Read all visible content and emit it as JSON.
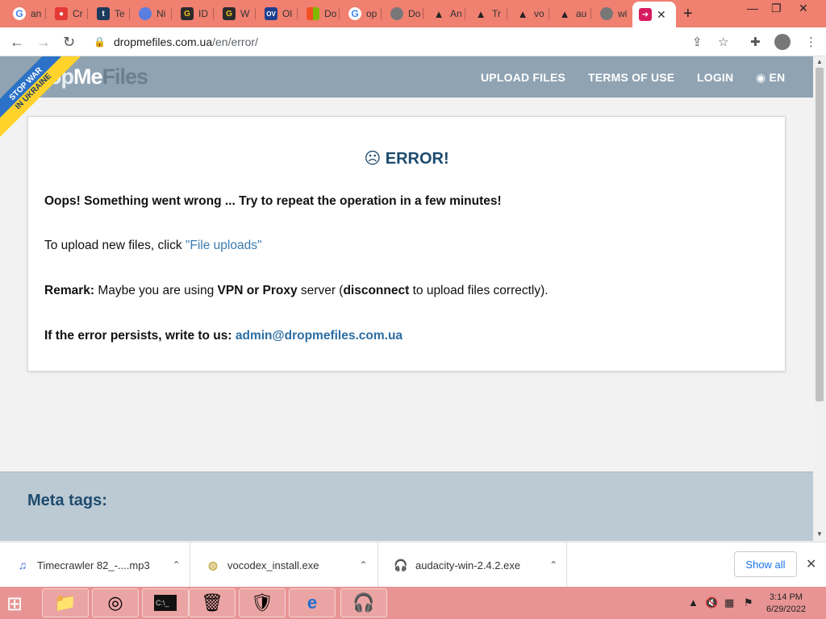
{
  "browser": {
    "tabs": [
      {
        "icon": "google-icon",
        "label": "an"
      },
      {
        "icon": "red-app-icon",
        "label": "Cr"
      },
      {
        "icon": "tumblr-icon",
        "label": "Te"
      },
      {
        "icon": "blue-drop-icon",
        "label": "Ni"
      },
      {
        "icon": "g-dark-icon",
        "label": "ID"
      },
      {
        "icon": "g-dark-icon",
        "label": "W"
      },
      {
        "icon": "ov-icon",
        "label": "Ol"
      },
      {
        "icon": "microsoft-icon",
        "label": "Do"
      },
      {
        "icon": "google-icon",
        "label": "op"
      },
      {
        "icon": "globe-icon",
        "label": "Do"
      },
      {
        "icon": "hill-icon",
        "label": "An"
      },
      {
        "icon": "hill-icon",
        "label": "Tr"
      },
      {
        "icon": "hill-icon",
        "label": "vo"
      },
      {
        "icon": "hill-icon",
        "label": "au"
      },
      {
        "icon": "globe-icon",
        "label": "wi"
      }
    ],
    "active_tab": {
      "icon": "dropmefiles-icon"
    },
    "url_host": "dropmefiles.com.ua",
    "url_path": "/en/error/"
  },
  "site": {
    "logo": {
      "part1": "op",
      "part2": "Me",
      "part3": "Files"
    },
    "ribbon": {
      "line1": "STOP WAR",
      "line2": "IN UKRAINE"
    },
    "nav": {
      "upload": "UPLOAD FILES",
      "terms": "TERMS OF USE",
      "login": "LOGIN",
      "lang": "EN"
    }
  },
  "error": {
    "face": "☹",
    "title": "ERROR!",
    "message": "Oops! Something went wrong ... Try to repeat the operation in a few minutes!",
    "upload_prefix": "To upload new files, click ",
    "upload_link": "\"File uploads\"",
    "remark_label": "Remark:",
    "remark_1": " Maybe you are using ",
    "remark_vpn": "VPN or Proxy",
    "remark_2": " server (",
    "remark_disconnect": "disconnect",
    "remark_3": " to upload files correctly).",
    "persist_label": "If the error persists, write to us: ",
    "email": "admin@dropmefiles.com.ua"
  },
  "meta": {
    "heading": "Meta tags:"
  },
  "downloads": {
    "items": [
      {
        "name": "Timecrawler 82_-....mp3"
      },
      {
        "name": "vocodex_install.exe"
      },
      {
        "name": "audacity-win-2.4.2.exe"
      }
    ],
    "show_all": "Show all"
  },
  "taskbar": {
    "time": "3:14 PM",
    "date": "6/29/2022"
  },
  "colors": {
    "tabstrip": "#f08070",
    "sitebar": "#8fa3b3",
    "error_title": "#1e4b6e",
    "link": "#3a7bb0",
    "taskbar": "#e89494"
  }
}
